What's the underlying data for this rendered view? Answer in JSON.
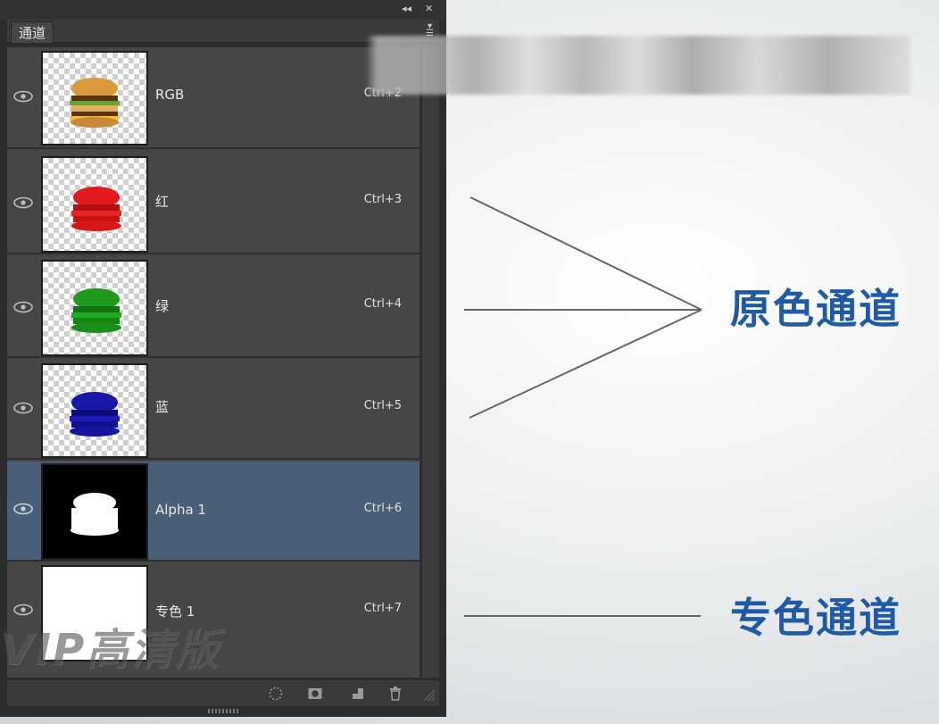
{
  "panel": {
    "tab_label": "通道",
    "collapse_button": "◂◂",
    "close_button": "✕",
    "channels": [
      {
        "name": "RGB",
        "shortcut": "Ctrl+2",
        "thumb": "color-burger"
      },
      {
        "name": "红",
        "shortcut": "Ctrl+3",
        "thumb": "red-burger"
      },
      {
        "name": "绿",
        "shortcut": "Ctrl+4",
        "thumb": "green-burger"
      },
      {
        "name": "蓝",
        "shortcut": "Ctrl+5",
        "thumb": "blue-burger"
      },
      {
        "name": "Alpha 1",
        "shortcut": "Ctrl+6",
        "thumb": "alpha-mask",
        "selected": true
      },
      {
        "name": "专色 1",
        "shortcut": "Ctrl+7",
        "thumb": "white"
      }
    ],
    "footer_icons": [
      "load-selection-icon",
      "save-selection-icon",
      "new-channel-icon",
      "trash-icon"
    ]
  },
  "annotations": {
    "primary_label": "原色通道",
    "spot_label": "专色通道"
  },
  "watermark": "VIP高清版",
  "colors": {
    "panel_bg": "#454545",
    "selected_row": "#4b5e78",
    "annotation_text": "#1f5aa6",
    "pointer_lines": "#666666"
  }
}
